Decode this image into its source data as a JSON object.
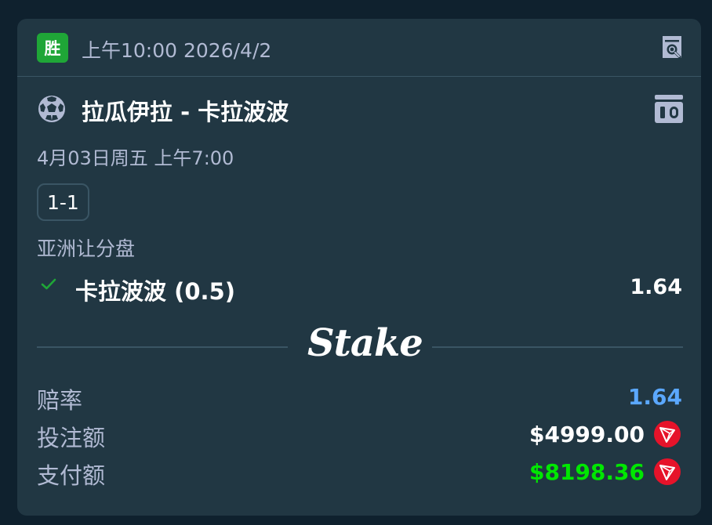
{
  "header": {
    "status_badge": "胜",
    "placed_time": "上午10:00 2026/4/2",
    "receipt_icon": "receipt-search-icon"
  },
  "match": {
    "sport_icon": "soccer-ball-icon",
    "title": "拉瓜伊拉 - 卡拉波波",
    "stats_icon": "match-stats-icon",
    "date": "4月03日周五  上午7:00",
    "score": "1-1"
  },
  "bet": {
    "market": "亚洲让分盘",
    "selection": "卡拉波波 (0.5)",
    "selection_odds": "1.64",
    "selection_status_icon": "check-icon"
  },
  "branding": {
    "logo": "Stake"
  },
  "summary": {
    "odds_label": "赔率",
    "odds_value": "1.64",
    "stake_label": "投注额",
    "stake_value": "$4999.00",
    "payout_label": "支付额",
    "payout_value": "$8198.36",
    "currency_icon": "tron-trx-icon"
  },
  "colors": {
    "background": "#0f212e",
    "card": "#213743",
    "win_green": "#1fa637",
    "odds_blue": "#5ba8ff",
    "payout_green": "#00e701",
    "tron_red": "#e6132a",
    "muted_text": "#b1bad3"
  }
}
